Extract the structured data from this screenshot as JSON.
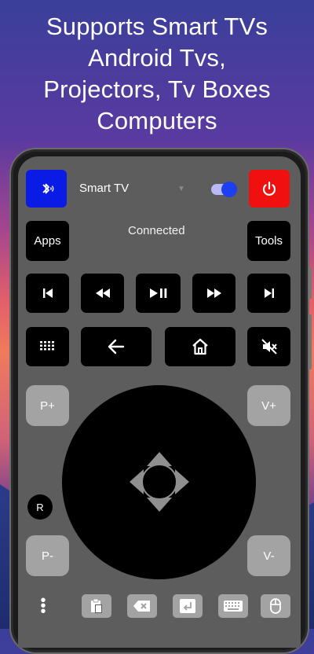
{
  "headline": {
    "line1": "Supports Smart TVs",
    "line2": "Android Tvs,",
    "line3": "Projectors, Tv Boxes",
    "line4": "Computers"
  },
  "remote": {
    "device_name": "Smart TV",
    "status": "Connected",
    "apps_label": "Apps",
    "tools_label": "Tools",
    "channel_up_label": "P+",
    "channel_down_label": "P-",
    "volume_up_label": "V+",
    "volume_down_label": "V-",
    "r_label": "R",
    "toggle_on": true
  },
  "colors": {
    "bluetooth": "#0a1be6",
    "power": "#f01010",
    "toggle_knob": "#1e3ff0",
    "screen_bg": "#5d5d5d"
  },
  "icons": {
    "bluetooth": "bluetooth-icon",
    "power": "power-icon",
    "previous": "skip-previous-icon",
    "rewind": "rewind-icon",
    "play_pause": "play-pause-icon",
    "fast_forward": "fast-forward-icon",
    "next": "skip-next-icon",
    "numpad": "numpad-icon",
    "back": "back-arrow-icon",
    "home": "home-icon",
    "mute": "mute-icon",
    "clipboard": "clipboard-icon",
    "backspace": "backspace-icon",
    "enter": "enter-icon",
    "keyboard": "keyboard-icon",
    "mouse": "mouse-icon",
    "more": "more-vertical-icon"
  }
}
